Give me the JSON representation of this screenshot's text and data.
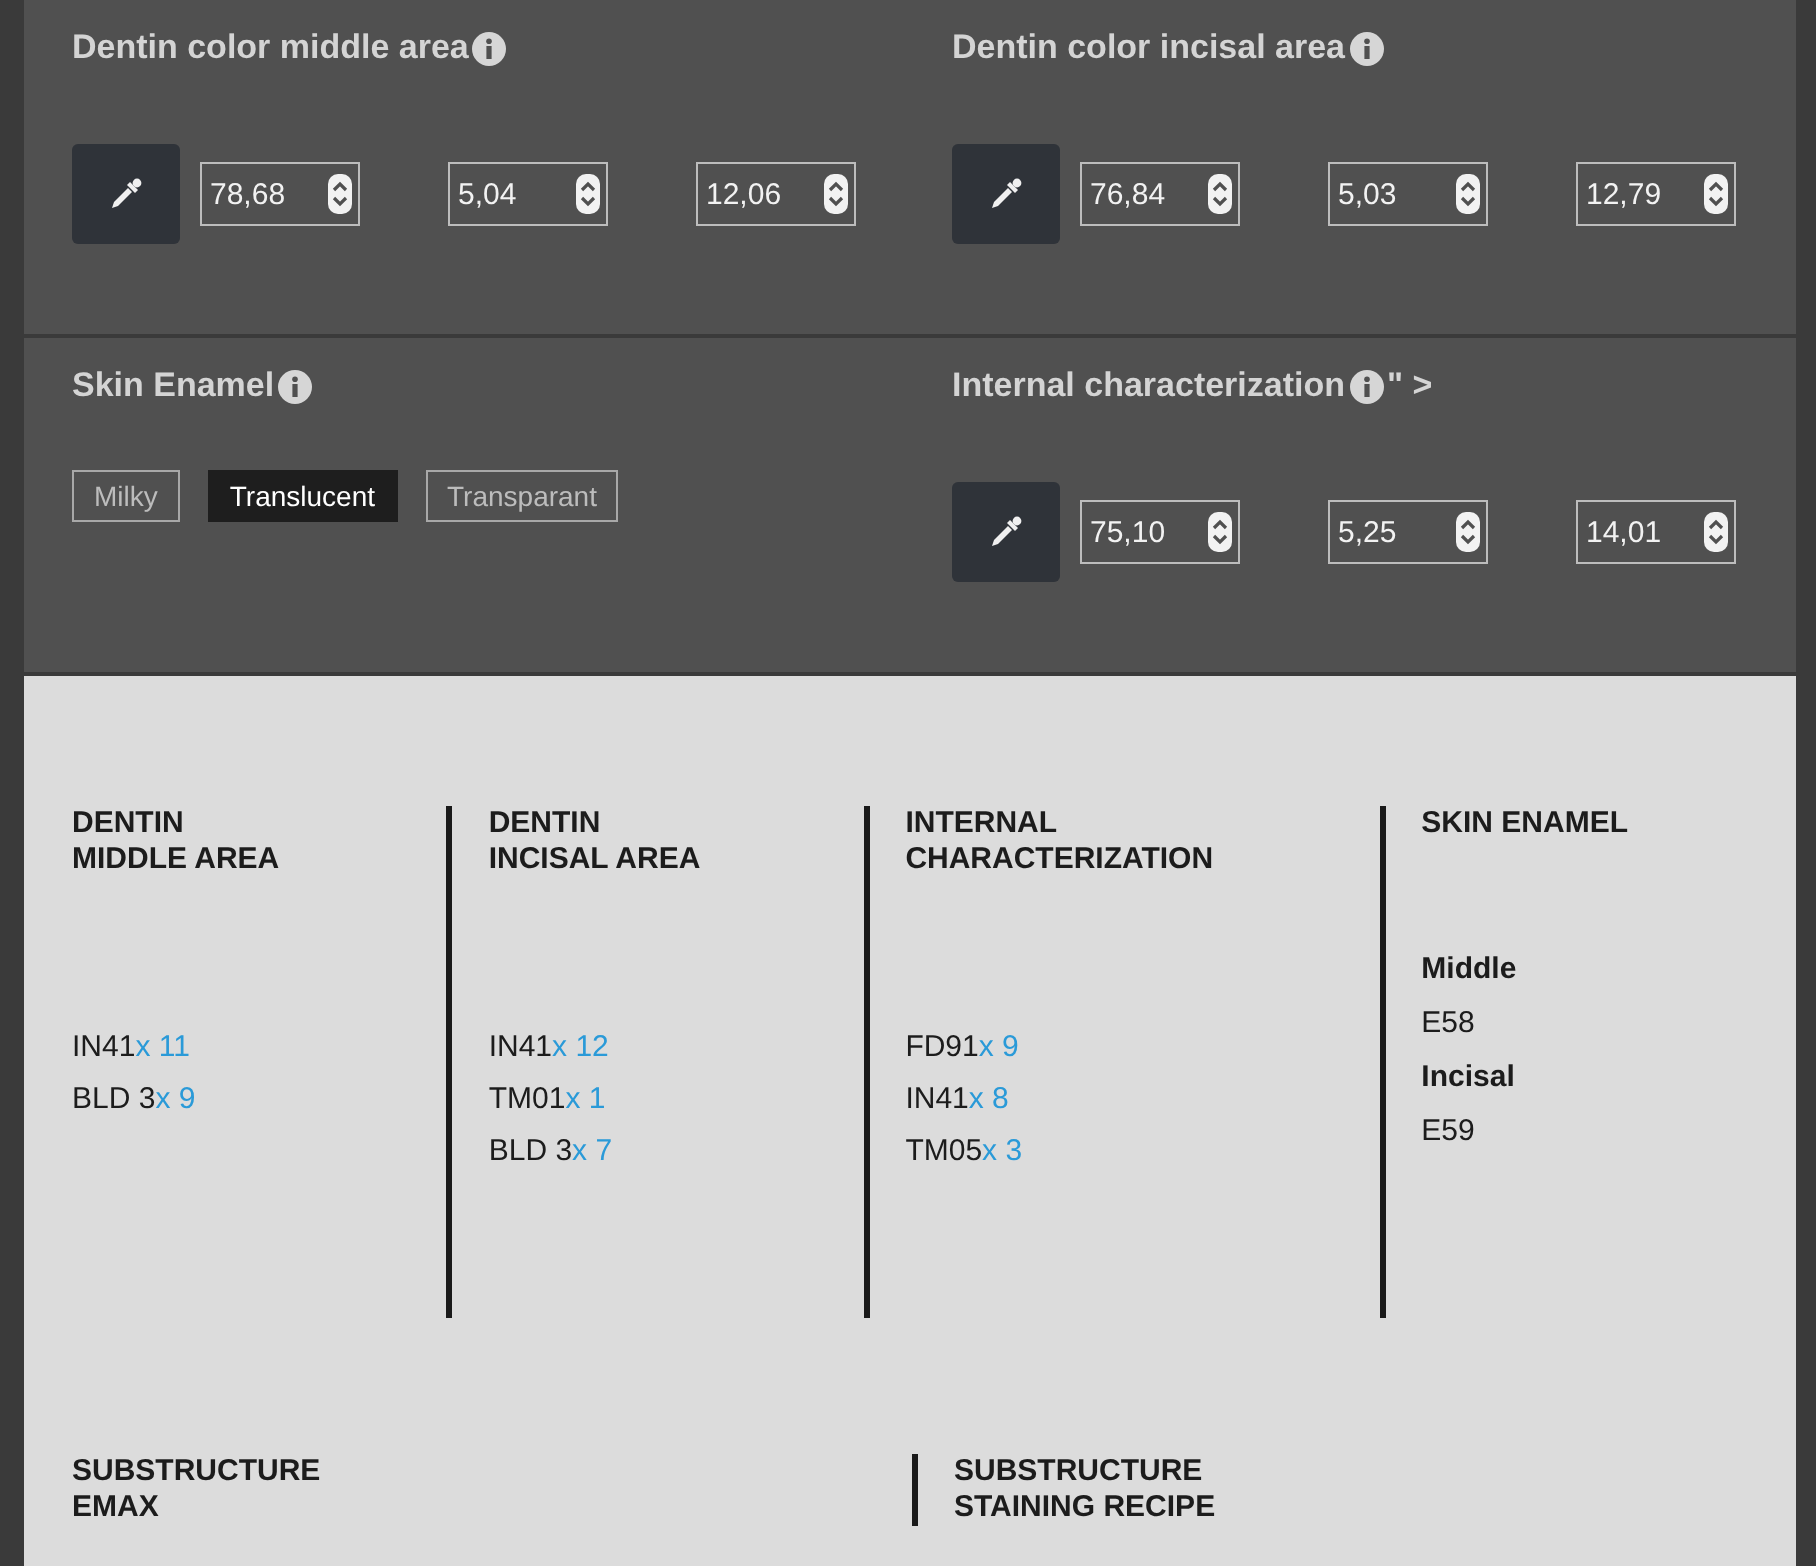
{
  "color_panels": [
    {
      "sections": [
        {
          "kind": "picker",
          "title": "Dentin color middle area",
          "values": [
            "78,68",
            "5,04",
            "12,06"
          ]
        },
        {
          "kind": "picker",
          "title": "Dentin color incisal area",
          "values": [
            "76,84",
            "5,03",
            "12,79"
          ]
        }
      ]
    },
    {
      "sections": [
        {
          "kind": "options",
          "title": "Skin Enamel",
          "options": [
            {
              "label": "Milky",
              "selected": false
            },
            {
              "label": "Translucent",
              "selected": true
            },
            {
              "label": "Transparant",
              "selected": false
            }
          ]
        },
        {
          "kind": "picker",
          "title": "Internal characterization",
          "suffix": "\" >",
          "values": [
            "75,10",
            "5,25",
            "14,01"
          ]
        }
      ]
    }
  ],
  "summary": {
    "columns": [
      {
        "kind": "recipe",
        "heading": [
          "DENTIN",
          "MIDDLE AREA"
        ],
        "items": [
          {
            "code": "IN41",
            "qty": "x 11"
          },
          {
            "code": "BLD 3",
            "qty": "x 9"
          }
        ]
      },
      {
        "kind": "recipe",
        "heading": [
          "DENTIN",
          "INCISAL AREA"
        ],
        "items": [
          {
            "code": "IN41",
            "qty": "x 12"
          },
          {
            "code": "TM01",
            "qty": "x 1"
          },
          {
            "code": "BLD 3",
            "qty": "x 7"
          }
        ]
      },
      {
        "kind": "recipe",
        "heading": [
          "INTERNAL",
          "CHARACTERIZATION"
        ],
        "items": [
          {
            "code": "FD91",
            "qty": "x 9"
          },
          {
            "code": "IN41",
            "qty": "x 8"
          },
          {
            "code": "TM05",
            "qty": "x 3"
          }
        ]
      },
      {
        "kind": "enamel",
        "heading": [
          "SKIN ENAMEL"
        ],
        "groups": [
          {
            "label": "Middle",
            "value": "E58"
          },
          {
            "label": "Incisal",
            "value": "E59"
          }
        ]
      }
    ],
    "substructure": [
      {
        "heading": [
          "SUBSTRUCTURE",
          "EMAX"
        ]
      },
      {
        "heading": [
          "SUBSTRUCTURE",
          "STAINING RECIPE"
        ]
      }
    ]
  }
}
